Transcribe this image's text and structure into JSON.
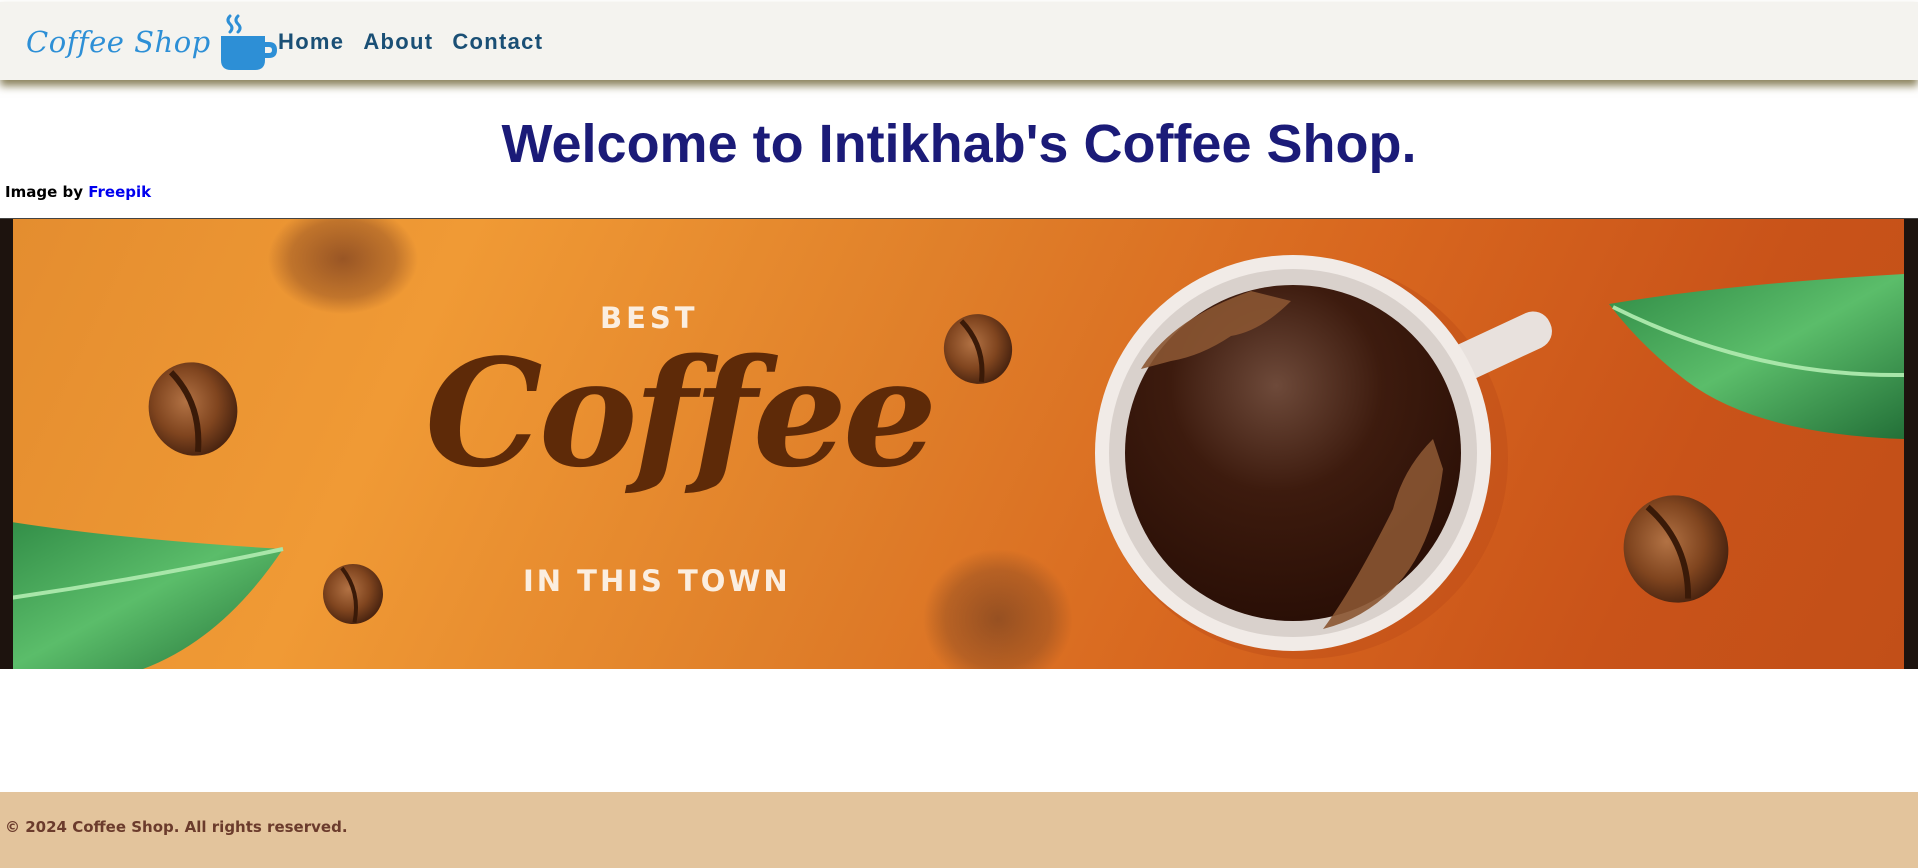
{
  "nav": {
    "logo_text": "Coffee Shop",
    "logo_icon": "coffee-cup-icon",
    "links": [
      "Home",
      "About",
      "Contact"
    ],
    "text_color": "#1a4f75",
    "logo_color": "#2d8fd6"
  },
  "main": {
    "heading": "Welcome to Intikhab's Coffee Shop.",
    "credit_prefix": "Image by",
    "credit_link": "Freepik"
  },
  "banner": {
    "top_text": "BEST",
    "script_text": "Coffee",
    "bottom_text": "IN THIS TOWN"
  },
  "footer": {
    "text": "© 2024 Coffee Shop. All rights reserved.",
    "background": "#e3c49c"
  }
}
